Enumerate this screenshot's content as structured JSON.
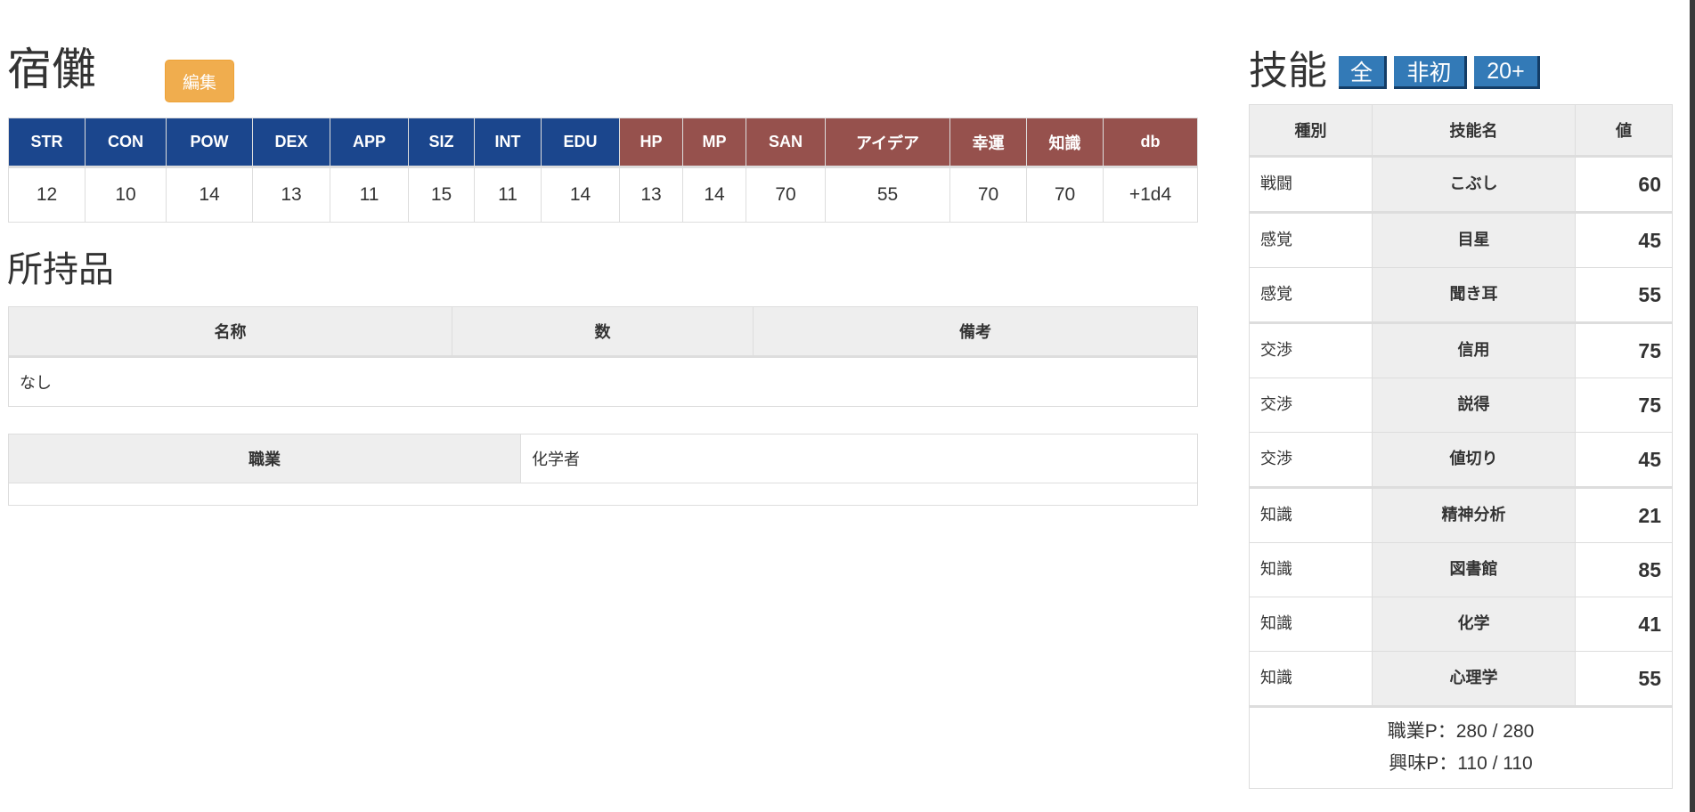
{
  "character": {
    "name": "宿儺",
    "edit_label": "編集"
  },
  "stats": {
    "headers": [
      "STR",
      "CON",
      "POW",
      "DEX",
      "APP",
      "SIZ",
      "INT",
      "EDU",
      "HP",
      "MP",
      "SAN",
      "アイデア",
      "幸運",
      "知識",
      "db"
    ],
    "values": [
      "12",
      "10",
      "14",
      "13",
      "11",
      "15",
      "11",
      "14",
      "13",
      "14",
      "70",
      "55",
      "70",
      "70",
      "+1d4"
    ]
  },
  "items": {
    "title": "所持品",
    "headers": [
      "名称",
      "数",
      "備考"
    ],
    "empty_text": "なし"
  },
  "occupation": {
    "label": "職業",
    "value": "化学者"
  },
  "skills": {
    "title": "技能",
    "filters": [
      "全",
      "非初",
      "20+"
    ],
    "headers": [
      "種別",
      "技能名",
      "値"
    ],
    "rows": [
      {
        "category": "戦闘",
        "name": "こぶし",
        "value": "60"
      },
      {
        "category": "感覚",
        "name": "目星",
        "value": "45"
      },
      {
        "category": "感覚",
        "name": "聞き耳",
        "value": "55"
      },
      {
        "category": "交渉",
        "name": "信用",
        "value": "75"
      },
      {
        "category": "交渉",
        "name": "説得",
        "value": "75"
      },
      {
        "category": "交渉",
        "name": "値切り",
        "value": "45"
      },
      {
        "category": "知識",
        "name": "精神分析",
        "value": "21"
      },
      {
        "category": "知識",
        "name": "図書館",
        "value": "85"
      },
      {
        "category": "知識",
        "name": "化学",
        "value": "41"
      },
      {
        "category": "知識",
        "name": "心理学",
        "value": "55"
      }
    ],
    "occupation_points": "職業P：280 / 280",
    "interest_points": "興味P：110 / 110"
  },
  "colors": {
    "physical_header": "#1b468d",
    "derived_header": "#96514d",
    "edit_button": "#f0ad4e",
    "filter_button": "#337ab7"
  }
}
